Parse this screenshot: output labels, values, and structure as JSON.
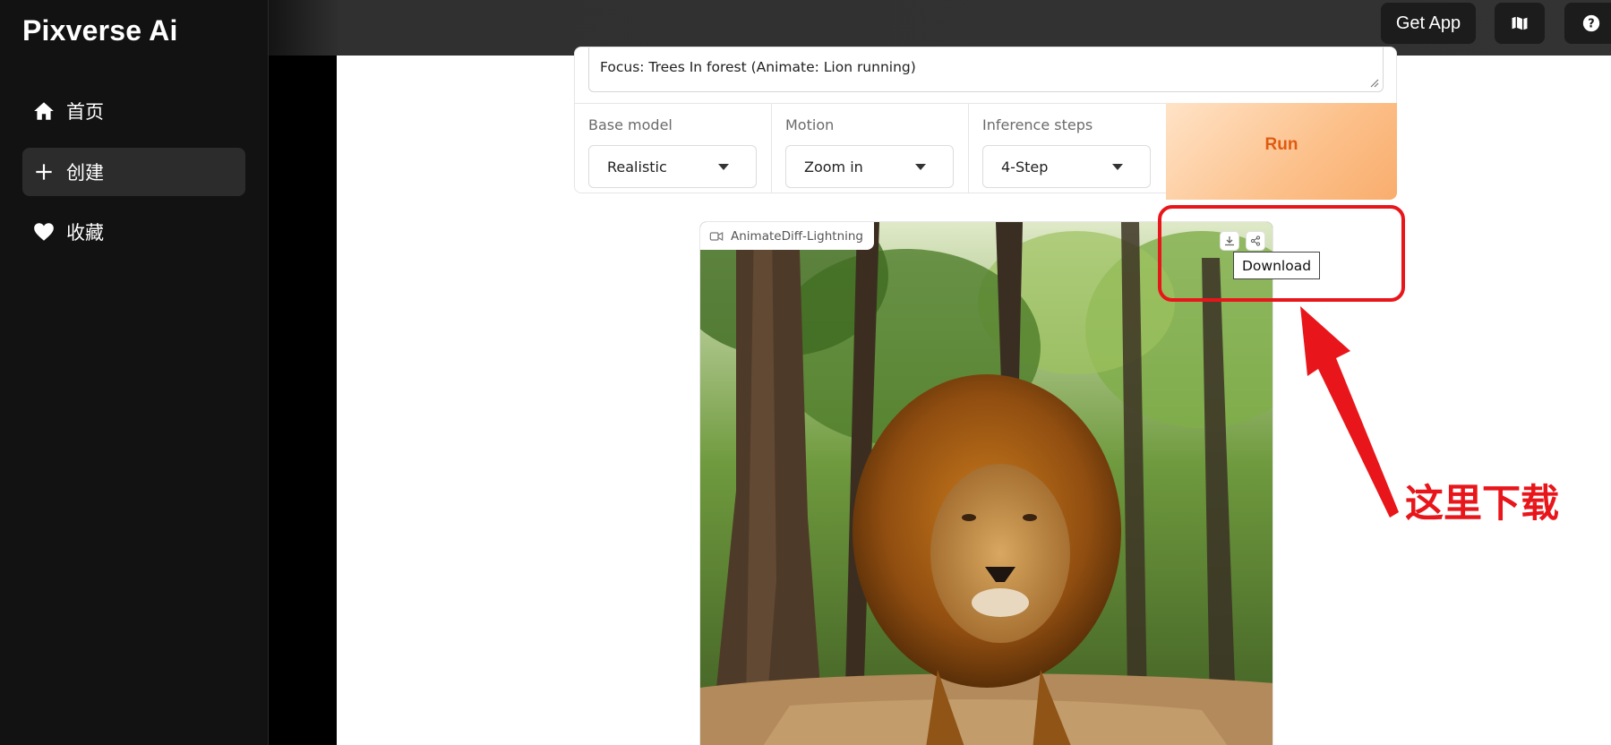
{
  "app": {
    "title": "Pixverse Ai"
  },
  "sidebar": {
    "items": [
      {
        "label": "首页",
        "icon": "home-icon"
      },
      {
        "label": "创建",
        "icon": "plus-icon",
        "active": true
      },
      {
        "label": "收藏",
        "icon": "heart-icon"
      }
    ]
  },
  "topbar": {
    "get_app_label": "Get App",
    "map_icon": "map-icon",
    "help_icon": "help-icon"
  },
  "form": {
    "prompt_value": "Focus: Trees In forest (Animate: Lion running)",
    "base_model": {
      "label": "Base model",
      "value": "Realistic"
    },
    "motion": {
      "label": "Motion",
      "value": "Zoom in"
    },
    "inference_steps": {
      "label": "Inference steps",
      "value": "4-Step"
    },
    "run_label": "Run"
  },
  "video": {
    "label": "AnimateDiff-Lightning",
    "label_icon": "video-camera-icon",
    "download_icon": "download-icon",
    "share_icon": "share-icon",
    "tooltip": "Download"
  },
  "annotation": {
    "text": "这里下载",
    "color": "#e8161b"
  },
  "colors": {
    "accent": "#e05b12",
    "sidebar_bg": "#121212",
    "annotation": "#e8161b"
  }
}
